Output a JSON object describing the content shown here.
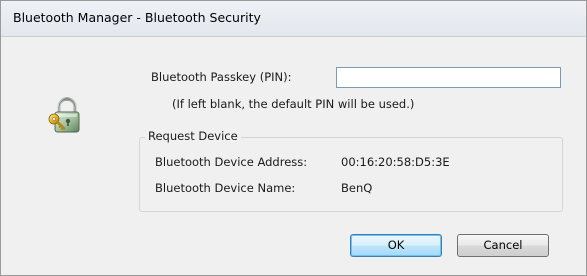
{
  "dialog": {
    "title": "Bluetooth Manager - Bluetooth Security"
  },
  "passkey": {
    "label": "Bluetooth Passkey (PIN):",
    "value": "",
    "hint": "(If left blank, the default PIN will be used.)"
  },
  "request_device": {
    "legend": "Request Device",
    "address_label": "Bluetooth Device Address:",
    "address_value": "00:16:20:58:D5:3E",
    "name_label": "Bluetooth Device Name:",
    "name_value": "BenQ"
  },
  "buttons": {
    "ok": "OK",
    "cancel": "Cancel"
  },
  "icons": {
    "main": "lock-key-icon"
  },
  "colors": {
    "titlebar": "#e6eaef",
    "dialog_bg": "#f0f0f0",
    "ok_border": "#3c7fb1"
  }
}
